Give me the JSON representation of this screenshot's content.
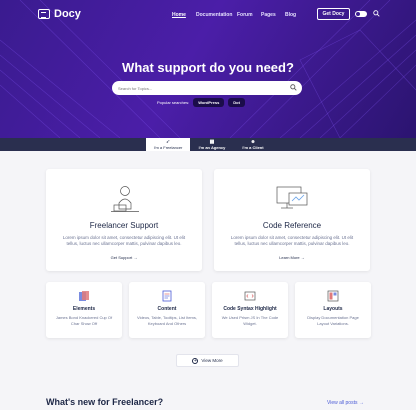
{
  "header": {
    "logo": "Docy",
    "nav": [
      "Home",
      "Documentation",
      "Forum",
      "Pages",
      "Blog"
    ],
    "cta": "Get Docy"
  },
  "hero": {
    "title": "What support do you need?",
    "search_placeholder": "Search for Topics...",
    "popular_label": "Popular searches:",
    "popular_tags": [
      "WordPress",
      "Dot"
    ]
  },
  "tabs": [
    "I'm a Freelancer",
    "I'm an Agency",
    "I'm a Client"
  ],
  "cards": [
    {
      "title": "Freelancer Support",
      "desc": "Lorem ipsum dolor sit amet, consectetur adipiscing elit. Ut elit tellus, luctus nec ullamcorper mattis, pulvinar dapibus leo.",
      "link": "Get Support"
    },
    {
      "title": "Code Reference",
      "desc": "Lorem ipsum dolor sit amet, consectetur adipiscing elit. Ut elit tellus, luctus nec ullamcorper mattis, pulvinar dapibus leo.",
      "link": "Learn More"
    }
  ],
  "features": [
    {
      "title": "Elements",
      "desc": "James Bond Knackered Cup Of Char Show Off"
    },
    {
      "title": "Content",
      "desc": "Videos, Table, Tooltips, List Items, Keyboard And Others"
    },
    {
      "title": "Code Syntax Highlight",
      "desc": "We Used Prism JS In The Code Widget."
    },
    {
      "title": "Layouts",
      "desc": "Display Documentation Page Layout Variations."
    }
  ],
  "view_more": "View More",
  "whats_new": "What's new for Freelancer?",
  "view_all": "View all posts",
  "colors": {
    "hero": "#3a1b8f",
    "tab_bar": "#2a2f4f",
    "link": "#4b5bd6",
    "text": "#1d2746"
  }
}
